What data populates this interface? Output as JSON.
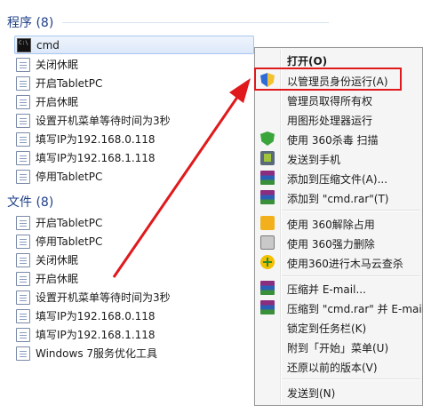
{
  "programs": {
    "header": "程序 (8)",
    "items": [
      {
        "label": "cmd",
        "icon": "cmd-icon"
      },
      {
        "label": "关闭休眠",
        "icon": "file-icon"
      },
      {
        "label": "开启TabletPC",
        "icon": "file-icon"
      },
      {
        "label": "开启休眠",
        "icon": "file-icon"
      },
      {
        "label": "设置开机菜单等待时间为3秒",
        "icon": "file-icon"
      },
      {
        "label": "填写IP为192.168.0.118",
        "icon": "file-icon"
      },
      {
        "label": "填写IP为192.168.1.118",
        "icon": "file-icon"
      },
      {
        "label": "停用TabletPC",
        "icon": "file-icon"
      }
    ]
  },
  "files": {
    "header": "文件 (8)",
    "items": [
      {
        "label": "开启TabletPC",
        "icon": "file-icon"
      },
      {
        "label": "停用TabletPC",
        "icon": "file-icon"
      },
      {
        "label": "关闭休眠",
        "icon": "file-icon"
      },
      {
        "label": "开启休眠",
        "icon": "file-icon"
      },
      {
        "label": "设置开机菜单等待时间为3秒",
        "icon": "file-icon"
      },
      {
        "label": "填写IP为192.168.0.118",
        "icon": "file-icon"
      },
      {
        "label": "填写IP为192.168.1.118",
        "icon": "file-icon"
      },
      {
        "label": "Windows 7服务优化工具",
        "icon": "file-icon"
      }
    ]
  },
  "context_menu": {
    "items": [
      {
        "label": "打开(O)",
        "icon": ""
      },
      {
        "label": "以管理员身份运行(A)",
        "icon": "uac-shield-icon"
      },
      {
        "label": "管理员取得所有权",
        "icon": ""
      },
      {
        "label": "用图形处理器运行",
        "icon": ""
      },
      {
        "label": "使用 360杀毒 扫描",
        "icon": "360-shield-icon"
      },
      {
        "label": "发送到手机",
        "icon": "phone-icon"
      },
      {
        "label": "添加到压缩文件(A)...",
        "icon": "winrar-icon"
      },
      {
        "label": "添加到 \"cmd.rar\"(T)",
        "icon": "winrar-icon"
      },
      {
        "label": "使用 360解除占用",
        "icon": "360-unlock-icon"
      },
      {
        "label": "使用 360强力删除",
        "icon": "shredder-icon"
      },
      {
        "label": "使用360进行木马云查杀",
        "icon": "360-plus-icon"
      },
      {
        "label": "压缩并 E-mail...",
        "icon": "winrar-icon"
      },
      {
        "label": "压缩到 \"cmd.rar\" 并 E-mail",
        "icon": "winrar-icon"
      },
      {
        "label": "锁定到任务栏(K)",
        "icon": ""
      },
      {
        "label": "附到「开始」菜单(U)",
        "icon": ""
      },
      {
        "label": "还原以前的版本(V)",
        "icon": ""
      },
      {
        "label": "发送到(N)",
        "icon": ""
      }
    ]
  },
  "colors": {
    "accent_header": "#1e3f87",
    "highlight_box": "#e0191c",
    "arrow": "#e0191c"
  }
}
